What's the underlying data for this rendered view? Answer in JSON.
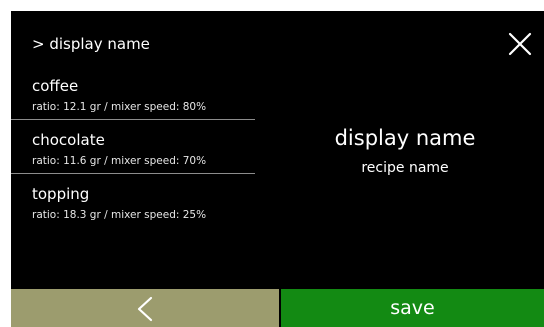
{
  "header": {
    "breadcrumb": "> display name",
    "close_icon": "close-icon"
  },
  "ingredients": [
    {
      "name": "coffee",
      "detail": "ratio: 12.1 gr / mixer speed: 80%"
    },
    {
      "name": "chocolate",
      "detail": "ratio: 11.6 gr / mixer speed: 70%"
    },
    {
      "name": "topping",
      "detail": "ratio: 18.3 gr / mixer speed: 25%"
    }
  ],
  "info": {
    "title": "display name",
    "subtitle": "recipe name"
  },
  "footer": {
    "back_icon": "chevron-left-icon",
    "save_label": "save"
  },
  "colors": {
    "background": "#000000",
    "back_button": "#9c9c6e",
    "save_button": "#138a13",
    "divider": "#8c8c8c"
  }
}
